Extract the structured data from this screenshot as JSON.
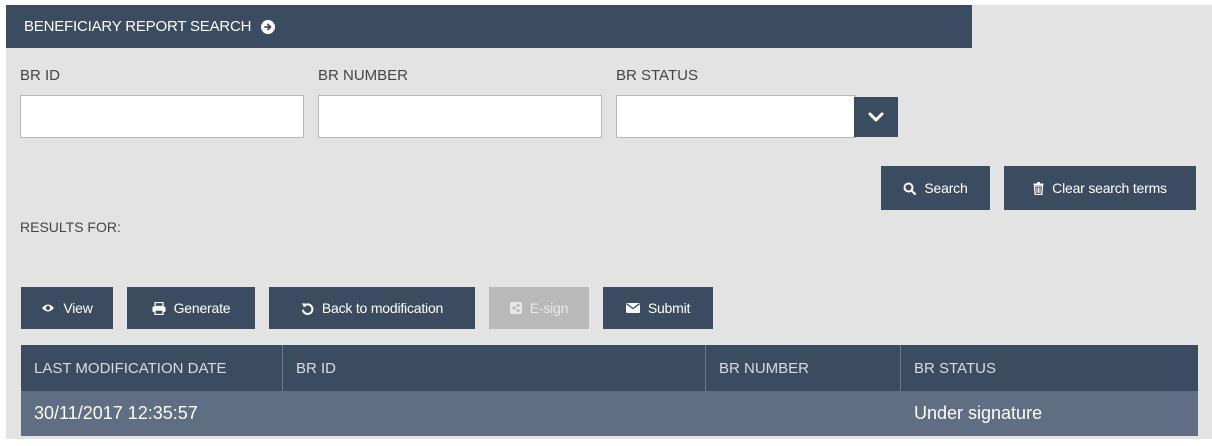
{
  "header": {
    "title": "BENEFICIARY REPORT SEARCH"
  },
  "filters": {
    "br_id_label": "BR ID",
    "br_number_label": "BR NUMBER",
    "br_status_label": "BR STATUS",
    "br_id_value": "",
    "br_number_value": "",
    "br_status_value": ""
  },
  "search_actions": {
    "search_label": "Search",
    "clear_label": "Clear search terms"
  },
  "results_label": "RESULTS FOR:",
  "toolbar": {
    "view_label": "View",
    "generate_label": "Generate",
    "back_label": "Back to modification",
    "esign_label": "E-sign",
    "submit_label": "Submit"
  },
  "table": {
    "columns": [
      "LAST MODIFICATION DATE",
      "BR ID",
      "BR NUMBER",
      "BR STATUS"
    ],
    "rows": [
      [
        "30/11/2017 12:35:57",
        "",
        "",
        "Under signature"
      ]
    ]
  },
  "colors": {
    "primary": "#3c4c60",
    "row_selected": "#5f6e82",
    "panel_bg": "#e3e3e3",
    "disabled": "#b9b9b9"
  },
  "icons": {
    "header": "arrow-right-circle-icon",
    "select": "chevron-down-icon",
    "search": "search-icon",
    "clear": "trash-icon",
    "view": "eye-icon",
    "generate": "printer-icon",
    "back": "undo-icon",
    "esign": "share-icon",
    "submit": "envelope-icon"
  }
}
